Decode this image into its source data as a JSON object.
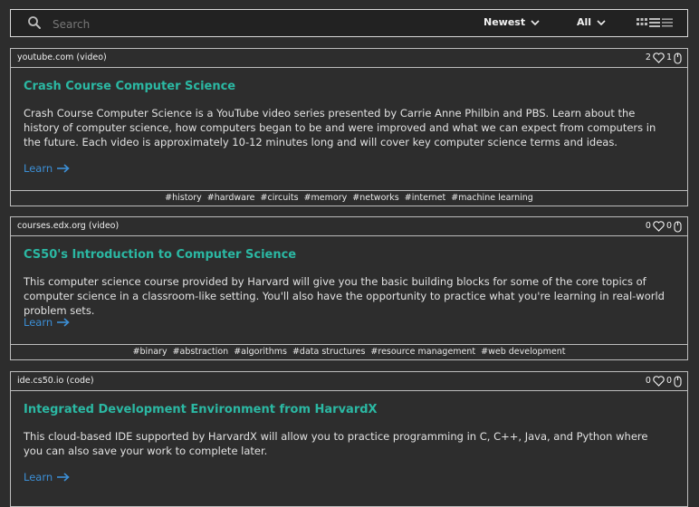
{
  "search": {
    "placeholder": "Search"
  },
  "sort": {
    "selected": "Newest"
  },
  "filter": {
    "selected": "All"
  },
  "icons": {
    "search": "search-icon",
    "grid": "grid-view-icon",
    "list": "list-view-icon",
    "compact": "compact-view-icon",
    "like": "heart-icon",
    "click": "mouse-icon",
    "arrow": "arrow-right-icon"
  },
  "colors": {
    "title": "#2bb8a3",
    "link": "#3c8fd6",
    "background": "#2d2d2d"
  },
  "cards": [
    {
      "source": "youtube.com (video)",
      "likes": "2",
      "clicks": "1",
      "title": "Crash Course Computer Science",
      "description": "Crash Course Computer Science is a YouTube video series presented by Carrie Anne Philbin and PBS. Learn about the history of computer science, how computers began to be and were improved and what we can expect from computers in the future. Each video is approximately 10-12 minutes long and will cover key computer science terms and ideas.",
      "link_label": "Learn",
      "tags": [
        "#history",
        "#hardware",
        "#circuits",
        "#memory",
        "#networks",
        "#internet",
        "#machine learning"
      ]
    },
    {
      "source": "courses.edx.org (video)",
      "likes": "0",
      "clicks": "0",
      "title": "CS50's Introduction to Computer Science",
      "description": "This computer science course provided by Harvard will give you the basic building blocks for some of the core topics of computer science in a classroom-like setting. You'll also have the opportunity to practice what you're learning in real-world problem sets.",
      "link_label": "Learn",
      "tags": [
        "#binary",
        "#abstraction",
        "#algorithms",
        "#data structures",
        "#resource management",
        "#web development"
      ]
    },
    {
      "source": "ide.cs50.io (code)",
      "likes": "0",
      "clicks": "0",
      "title": "Integrated Development Environment from HarvardX",
      "description": "This cloud-based IDE supported by HarvardX will allow you to practice programming in C, C++, Java, and Python where you can also save your work to complete later.",
      "link_label": "Learn",
      "tags": []
    }
  ]
}
